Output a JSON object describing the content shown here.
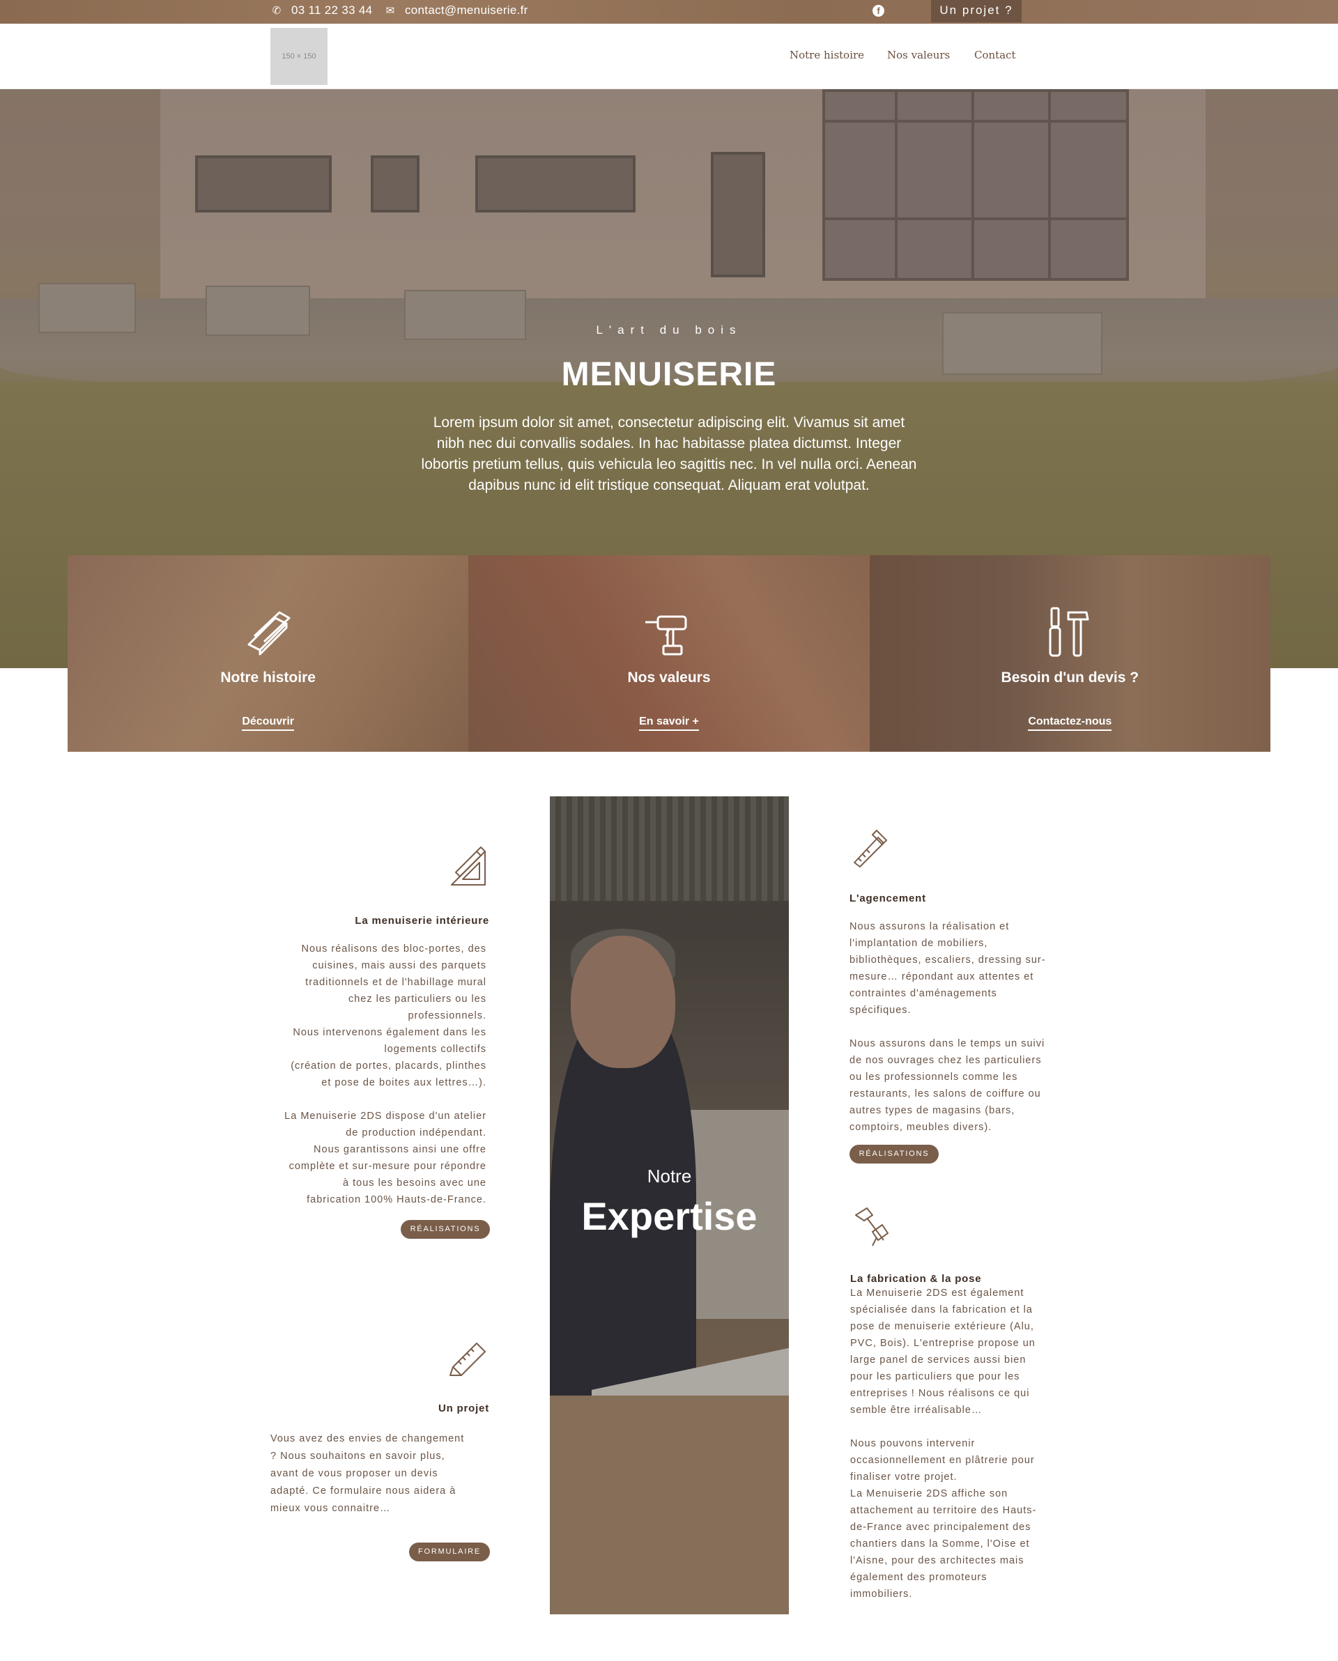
{
  "topbar": {
    "phone": "03 11 22 33 44",
    "email": "contact@menuiserie.fr",
    "social_icon": "facebook-icon",
    "project_button": "Un projet ?"
  },
  "header": {
    "logo_placeholder": "150 × 150",
    "nav": [
      "Notre histoire",
      "Nos valeurs",
      "Contact"
    ]
  },
  "hero": {
    "subtitle": "L'art du bois",
    "title": "MENUISERIE",
    "text": "Lorem ipsum dolor sit amet, consectetur adipiscing elit. Vivamus sit amet nibh nec dui convallis sodales. In hac habitasse platea dictumst. Integer lobortis pretium tellus, quis vehicula leo sagittis nec. In vel nulla orci. Aenean dapibus nunc id elit tristique consequat. Aliquam erat volutpat."
  },
  "cards": [
    {
      "title": "Notre histoire",
      "link": "Découvrir",
      "icon": "wood-planks-icon"
    },
    {
      "title": "Nos valeurs",
      "link": "En savoir +",
      "icon": "drill-icon"
    },
    {
      "title": "Besoin d'un devis ?",
      "link": "Contactez-nous",
      "icon": "tools-icon"
    }
  ],
  "expertise": {
    "photo_sub": "Notre",
    "photo_title": "Expertise",
    "interior": {
      "title": "La menuiserie intérieure",
      "p1": [
        "Nous réalisons des bloc-portes, des",
        "cuisines, mais aussi des parquets",
        "traditionnels et de l'habillage mural",
        "chez les particuliers ou les",
        "professionnels.",
        "Nous intervenons également dans les",
        "logements collectifs",
        "(création de portes, placards, plinthes",
        "et pose de boites aux lettres…)."
      ],
      "p2": [
        "La Menuiserie 2DS dispose d'un atelier",
        "de production indépendant.",
        "Nous garantissons ainsi une offre",
        "complète et sur-mesure pour répondre",
        "à tous les besoins avec une",
        "fabrication 100% Hauts-de-France."
      ],
      "button": "RÉALISATIONS",
      "icon": "ruler-pencil-icon"
    },
    "project": {
      "title": "Un projet",
      "p1": [
        "Vous avez des envies de changement",
        "? Nous souhaitons en savoir plus,",
        "avant de vous proposer un devis",
        "adapté. Ce formulaire nous aidera à",
        "mieux vous connaitre…"
      ],
      "button": "FORMULAIRE",
      "icon": "tape-measure-icon"
    },
    "layout": {
      "title": "L'agencement",
      "p1": [
        "Nous assurons la réalisation et",
        "l'implantation de mobiliers,",
        "bibliothèques, escaliers, dressing sur-",
        "mesure… répondant aux attentes et",
        "contraintes d'aménagements",
        "spécifiques."
      ],
      "p2": [
        "Nous assurons dans le temps un suivi",
        "de nos ouvrages chez les particuliers",
        "ou les professionnels comme les",
        "restaurants, les salons de coiffure ou",
        "autres types de magasins (bars,",
        "comptoirs, meubles divers)."
      ],
      "button": "RÉALISATIONS",
      "icon": "saw-icon"
    },
    "fabrication": {
      "title": "La fabrication & la pose",
      "p1": [
        "La Menuiserie 2DS est également",
        "spécialisée dans la fabrication et la",
        "pose de menuiserie extérieure (Alu,",
        "PVC, Bois). L'entreprise propose un",
        "large panel de services aussi bien",
        "pour les particuliers que pour les",
        "entreprises ! Nous réalisons ce qui",
        "semble être irréalisable…"
      ],
      "p2": [
        "Nous pouvons intervenir",
        "occasionnellement en plâtrerie pour",
        "finaliser votre projet.",
        "La Menuiserie 2DS affiche son",
        "attachement au territoire des Hauts-",
        "de-France avec principalement des",
        "chantiers dans la Somme, l'Oise et",
        "l'Aisne, pour des architectes mais",
        "également des promoteurs",
        "immobiliers."
      ],
      "icon": "hammer-icon"
    }
  }
}
